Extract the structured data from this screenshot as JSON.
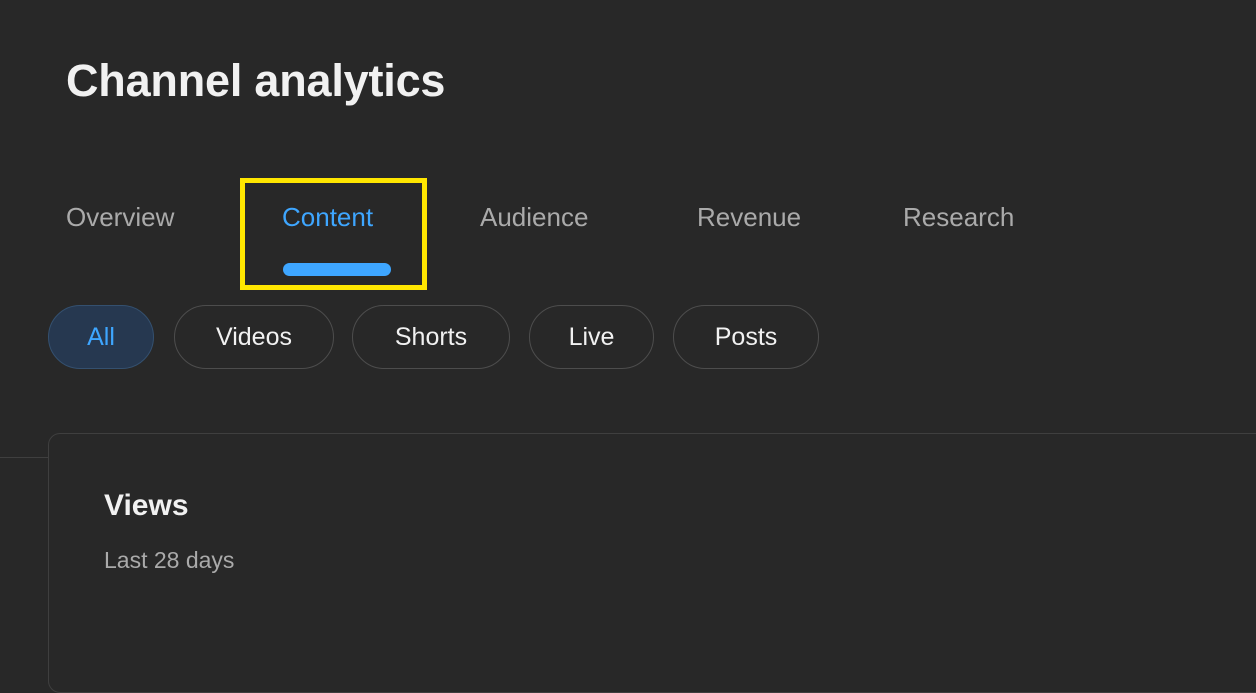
{
  "page": {
    "title": "Channel analytics",
    "background_color": "#282828",
    "accent_color": "#3ea6ff",
    "highlight_color": "#ffe600"
  },
  "tabs": [
    {
      "label": "Overview",
      "active": false
    },
    {
      "label": "Content",
      "active": true
    },
    {
      "label": "Audience",
      "active": false
    },
    {
      "label": "Revenue",
      "active": false
    },
    {
      "label": "Research",
      "active": false
    }
  ],
  "filters": {
    "chips": [
      {
        "label": "All",
        "selected": true
      },
      {
        "label": "Videos",
        "selected": false
      },
      {
        "label": "Shorts",
        "selected": false
      },
      {
        "label": "Live",
        "selected": false
      },
      {
        "label": "Posts",
        "selected": false
      }
    ]
  },
  "cards": [
    {
      "title": "Views",
      "subtitle": "Last 28 days"
    }
  ]
}
